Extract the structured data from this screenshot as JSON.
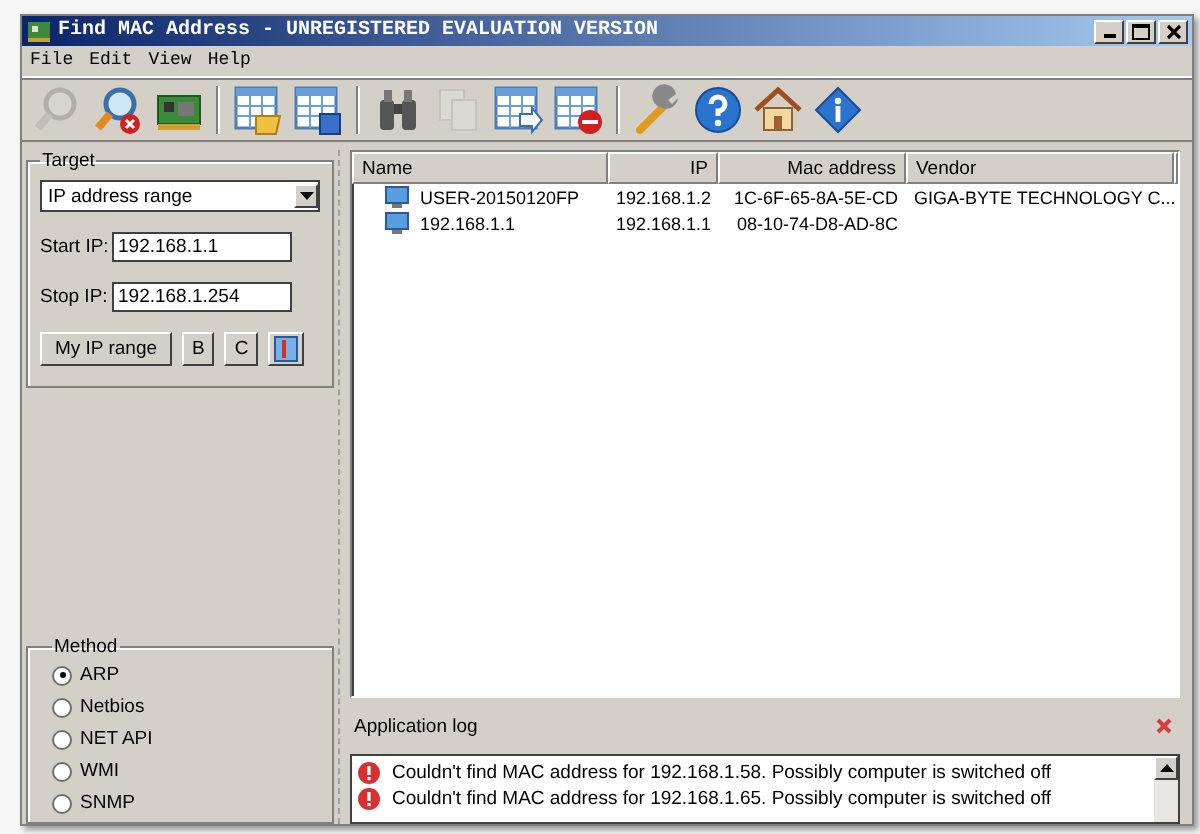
{
  "window": {
    "title": "Find MAC Address - UNREGISTERED EVALUATION VERSION"
  },
  "menu": [
    "File",
    "Edit",
    "View",
    "Help"
  ],
  "toolbar": [
    {
      "kind": "search",
      "disabled": true
    },
    {
      "kind": "search-stop",
      "disabled": false
    },
    {
      "kind": "card",
      "disabled": false
    },
    {
      "kind": "sep"
    },
    {
      "kind": "table-open",
      "disabled": false
    },
    {
      "kind": "table-save",
      "disabled": false
    },
    {
      "kind": "sep"
    },
    {
      "kind": "binoculars",
      "disabled": false
    },
    {
      "kind": "copy",
      "disabled": true
    },
    {
      "kind": "table-export",
      "disabled": false
    },
    {
      "kind": "table-remove",
      "disabled": false
    },
    {
      "kind": "sep"
    },
    {
      "kind": "wrench",
      "disabled": false
    },
    {
      "kind": "help",
      "disabled": false
    },
    {
      "kind": "home",
      "disabled": false
    },
    {
      "kind": "info",
      "disabled": false
    }
  ],
  "target": {
    "title": "Target",
    "mode": "IP address range",
    "start_label": "Start IP:",
    "start_value": "192.168.1.1",
    "stop_label": "Stop IP:",
    "stop_value": "192.168.1.254",
    "buttons": [
      "My IP range",
      "B",
      "C"
    ]
  },
  "method": {
    "title": "Method",
    "options": [
      {
        "label": "ARP",
        "selected": true
      },
      {
        "label": "Netbios",
        "selected": false
      },
      {
        "label": "NET API",
        "selected": false
      },
      {
        "label": "WMI",
        "selected": false
      },
      {
        "label": "SNMP",
        "selected": false
      }
    ]
  },
  "table": {
    "columns": [
      "Name",
      "IP",
      "Mac address",
      "Vendor"
    ],
    "rows": [
      {
        "name": "USER-20150120FP",
        "ip": "192.168.1.2",
        "mac": "1C-6F-65-8A-5E-CD",
        "vendor": "GIGA-BYTE TECHNOLOGY C..."
      },
      {
        "name": "192.168.1.1",
        "ip": "192.168.1.1",
        "mac": "08-10-74-D8-AD-8C",
        "vendor": ""
      }
    ]
  },
  "log": {
    "title": "Application log",
    "entries": [
      "Couldn't find MAC address for 192.168.1.58. Possibly computer is switched off",
      "Couldn't find MAC address for 192.168.1.65. Possibly computer is switched off"
    ]
  }
}
